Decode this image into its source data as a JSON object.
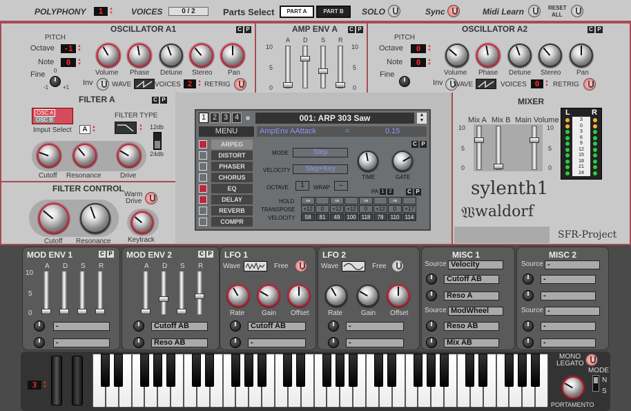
{
  "topbar": {
    "polyphony_label": "POLYPHONY",
    "polyphony_value": "1",
    "voices_label": "VOICES",
    "voices_value": "0 / 2",
    "parts_select_label": "Parts Select",
    "part_a": "PART A",
    "part_b": "PART B",
    "solo_label": "SOLO",
    "sync_label": "Sync",
    "midi_learn_label": "Midi Learn",
    "reset_all_label_1": "RESET",
    "reset_all_label_2": "ALL"
  },
  "osc_a1": {
    "title": "OSCILLATOR A1",
    "pitch": "PITCH",
    "octave_label": "Octave",
    "octave_value": "-1",
    "note_label": "Note",
    "note_value": "0",
    "fine_label": "Fine",
    "fine_min": "-1",
    "fine_zero": "0",
    "fine_max": "+1",
    "knobs": [
      "Volume",
      "Phase",
      "Detune",
      "Stereo",
      "Pan"
    ],
    "inv": "Inv",
    "wave": "WAVE",
    "voices": "VOICES",
    "voices_value": "2",
    "retrig": "RETRIG"
  },
  "amp_env": {
    "title": "AMP ENV A",
    "labels": [
      "A",
      "D",
      "S",
      "R"
    ],
    "scale": [
      "10",
      "5",
      "0"
    ]
  },
  "osc_a2": {
    "title": "OSCILLATOR A2",
    "pitch": "PITCH",
    "octave_label": "Octave",
    "octave_value": "0",
    "note_label": "Note",
    "note_value": "0",
    "fine_label": "Fine",
    "knobs": [
      "Volume",
      "Phase",
      "Detune",
      "Stereo",
      "Pan"
    ],
    "inv": "Inv",
    "wave": "WAVE",
    "voices": "VOICES",
    "voices_value": "0",
    "retrig": "RETRIG"
  },
  "filter_a": {
    "title": "FILTER  A",
    "osc_a": "OSC A",
    "osc_b": "OSC B",
    "input_select": "Imput Select",
    "input_value": "A",
    "filter_type": "FILTER TYPE",
    "db12": "12db",
    "db24": "24db",
    "knobs": [
      "Cutoff",
      "Resonance",
      "Drive"
    ]
  },
  "filter_control": {
    "title": "FILTER  CONTROL",
    "warm_1": "Warm",
    "warm_2": "Drive",
    "knobs": [
      "Cutoff",
      "Resonance",
      "Keytrack"
    ]
  },
  "display": {
    "tabs": [
      "1",
      "2",
      "3",
      "4"
    ],
    "preset": "001: ARP 303 Saw",
    "menu": "MENU",
    "param_name": "AmpEnv AAttack",
    "param_eq": "=",
    "param_value": "0.15",
    "menu_items": [
      {
        "label": "ARPEG",
        "on": true
      },
      {
        "label": "DISTORT",
        "on": false
      },
      {
        "label": "PHASER",
        "on": false
      },
      {
        "label": "CHORUS",
        "on": false
      },
      {
        "label": "EQ",
        "on": true
      },
      {
        "label": "DELAY",
        "on": true
      },
      {
        "label": "REVERB",
        "on": false
      },
      {
        "label": "COMPR",
        "on": false
      }
    ],
    "mode_label": "MODE",
    "mode_value": "Step",
    "velocity_label": "VELOCITY",
    "velocity_value": "Step+Key",
    "octave_label": "OCTAVE",
    "octave_value": "1",
    "wrap_label": "WRAP",
    "wrap_value": "–",
    "time_label": "TIME",
    "gate_label": "GATE",
    "pa_label": "PA",
    "pa_1": "1",
    "pa_2": "2",
    "hold_label": "HOLD",
    "transpose_label": "TRANSPOSE",
    "transpose": [
      "+12",
      "0",
      "+12",
      "+12",
      "0",
      "+12",
      "0",
      "+17"
    ],
    "velocity_row_label": "VELOCITY",
    "velocities": [
      "58",
      "81",
      "49",
      "100",
      "118",
      "78",
      "110",
      "114"
    ]
  },
  "mixer": {
    "title": "MIXER",
    "mix_a": "Mix A",
    "mix_b": "Mix B",
    "main_volume": "Main Volume",
    "scale": [
      "10",
      "5",
      "0"
    ],
    "meter_l": "L",
    "meter_r": "R",
    "meter_marks": [
      "3",
      "0",
      "3",
      "6",
      "9",
      "12",
      "15",
      "18",
      "21",
      "24"
    ]
  },
  "brand": {
    "name": "sylenth1",
    "maker": "waldorf",
    "footer": "SFR-Project"
  },
  "mod_env_1": {
    "title": "MOD ENV  1",
    "labels": [
      "A",
      "D",
      "S",
      "R"
    ],
    "scale": [
      "10",
      "5",
      "0"
    ],
    "dest_1": "-",
    "dest_2": "-"
  },
  "mod_env_2": {
    "title": "MOD ENV  2",
    "labels": [
      "A",
      "D",
      "S",
      "R"
    ],
    "dest_1": "Cutoff AB",
    "dest_2": "Reso AB"
  },
  "lfo_1": {
    "title": "LFO 1",
    "wave": "Wave",
    "free": "Free",
    "knobs": [
      "Rate",
      "Gain",
      "Offset"
    ],
    "dest_1": "Cutoff AB",
    "dest_2": "-"
  },
  "lfo_2": {
    "title": "LFO 2",
    "wave": "Wave",
    "free": "Free",
    "knobs": [
      "Rate",
      "Gain",
      "Offset"
    ],
    "dest_1": "-",
    "dest_2": "-"
  },
  "misc_1": {
    "title": "MISC 1",
    "source_label": "Source",
    "source_1": "Velocity",
    "dest_1a": "Cutoff AB",
    "dest_1b": "Reso A",
    "source_2": "ModWheel",
    "dest_2a": "Reso AB",
    "dest_2b": "Mix AB"
  },
  "misc_2": {
    "title": "MISC 2",
    "source_label": "Source",
    "source_1": "-",
    "dest_1a": "-",
    "dest_1b": "-",
    "source_2": "-",
    "dest_2a": "-",
    "dest_2b": "-"
  },
  "keyboard": {
    "octave_value": "3",
    "mono_legato_1": "MONO",
    "mono_legato_2": "LEGATO",
    "mode": "MODE",
    "mode_n": "N",
    "mode_s": "S",
    "portamento": "PORTAMENTO"
  },
  "colors": {
    "accent": "#c0273a",
    "panel": "#c9c9c9",
    "dark": "#4a4a4a"
  }
}
